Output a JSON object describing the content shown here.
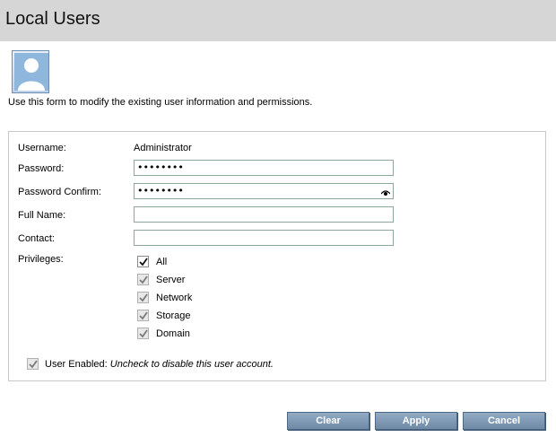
{
  "header": {
    "title": "Local Users"
  },
  "intro_text": "Use this form to modify the existing user information and permissions.",
  "form": {
    "username_label": "Username:",
    "username_value": "Administrator",
    "password_label": "Password:",
    "password_value": "••••••••",
    "password_confirm_label": "Password Confirm:",
    "password_confirm_value": "••••••••",
    "full_name_label": "Full Name:",
    "full_name_value": "",
    "contact_label": "Contact:",
    "contact_value": "",
    "privileges_label": "Privileges:",
    "privileges": [
      {
        "label": "All",
        "checked": true,
        "enabled": true
      },
      {
        "label": "Server",
        "checked": true,
        "enabled": false
      },
      {
        "label": "Network",
        "checked": true,
        "enabled": false
      },
      {
        "label": "Storage",
        "checked": true,
        "enabled": false
      },
      {
        "label": "Domain",
        "checked": true,
        "enabled": false
      }
    ],
    "user_enabled_label": "User Enabled:",
    "user_enabled_hint": "Uncheck to disable this user account.",
    "user_enabled_checked": true
  },
  "buttons": {
    "clear": "Clear",
    "apply": "Apply",
    "cancel": "Cancel"
  },
  "colors": {
    "button": "#7f98b3",
    "header_bg": "#d6d6d6"
  }
}
